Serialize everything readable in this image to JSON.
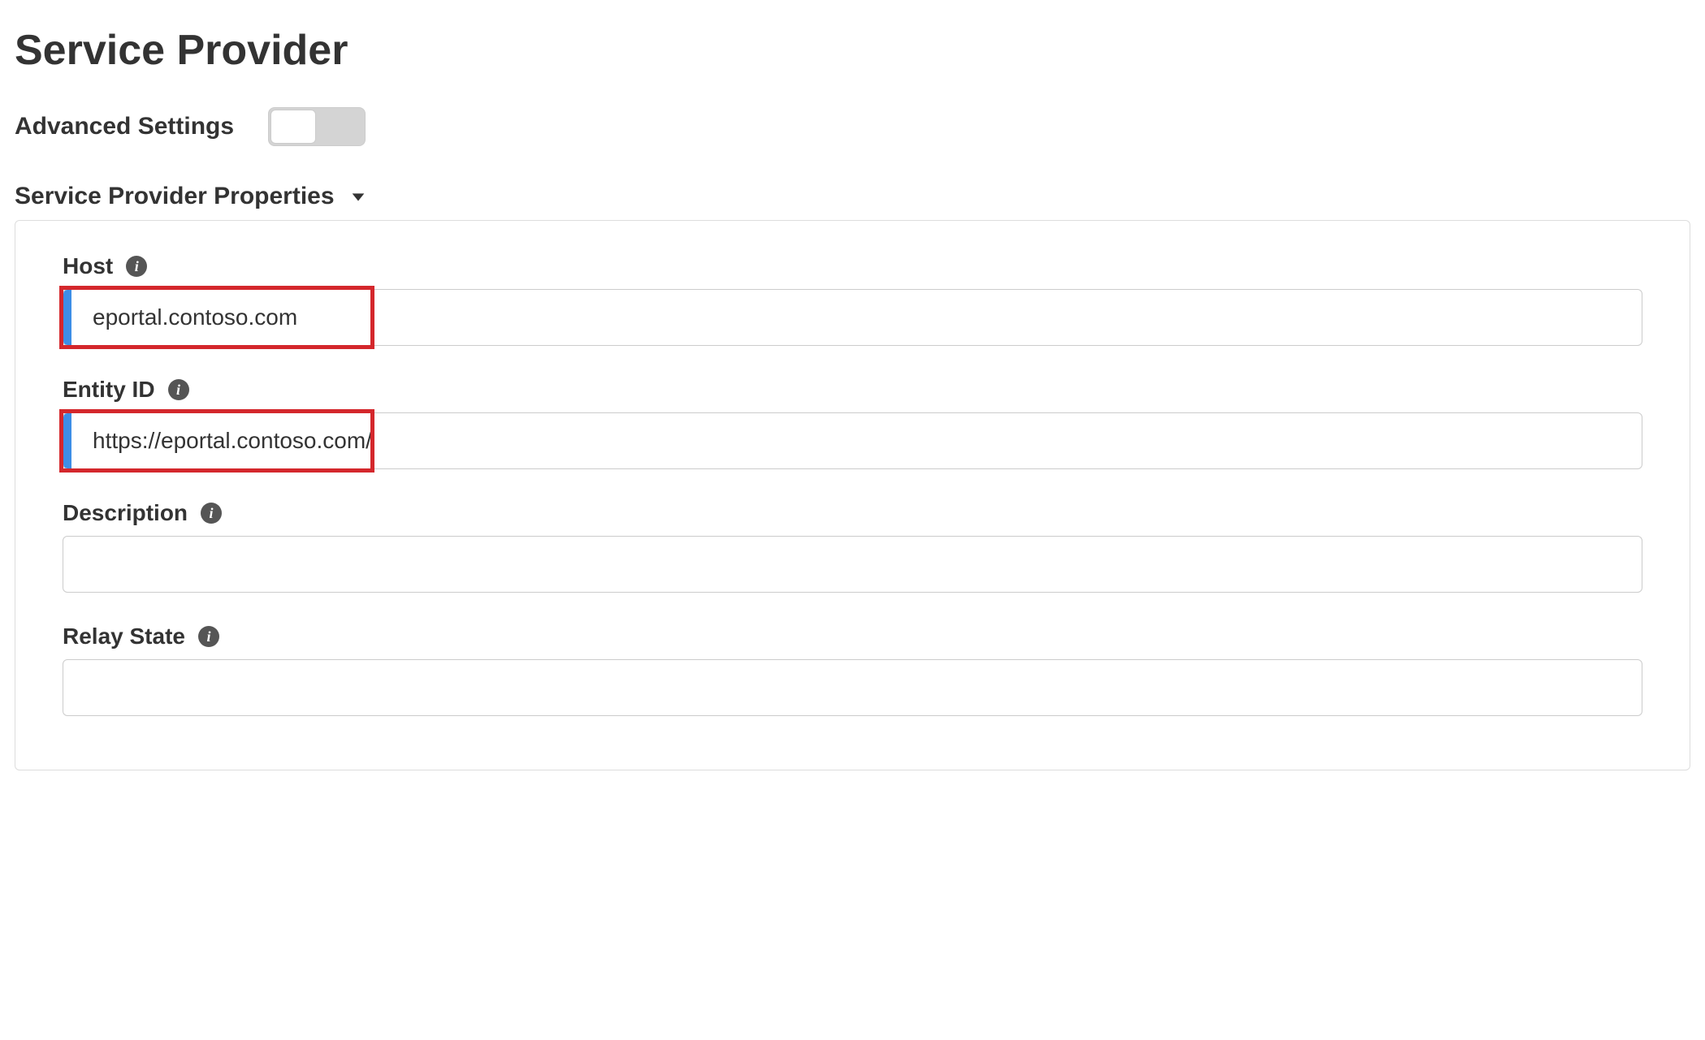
{
  "page": {
    "title": "Service Provider"
  },
  "advanced_settings": {
    "label": "Advanced Settings",
    "enabled": false
  },
  "section": {
    "title": "Service Provider Properties",
    "expanded": true
  },
  "fields": {
    "host": {
      "label": "Host",
      "value": "eportal.contoso.com"
    },
    "entity_id": {
      "label": "Entity ID",
      "value": "https://eportal.contoso.com/"
    },
    "description": {
      "label": "Description",
      "value": ""
    },
    "relay_state": {
      "label": "Relay State",
      "value": ""
    }
  },
  "icons": {
    "info_glyph": "i"
  }
}
